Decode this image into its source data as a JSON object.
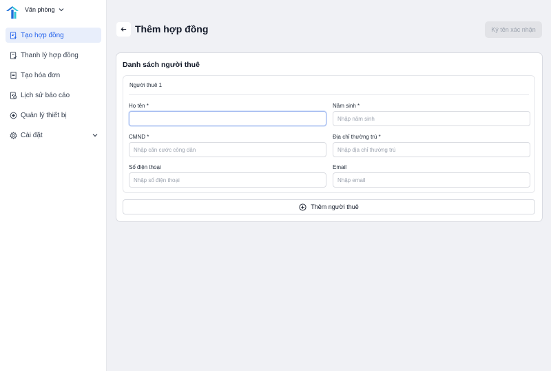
{
  "workspace": {
    "name": "Văn phòng",
    "logo_icon": "house-logo-icon",
    "dropdown_icon": "chevron-down-icon"
  },
  "sidebar": {
    "items": [
      {
        "label": "Tạo hợp đồng",
        "icon": "document-add-icon",
        "active": true
      },
      {
        "label": "Thanh lý hợp đồng",
        "icon": "document-check-icon",
        "active": false
      },
      {
        "label": "Tạo hóa đơn",
        "icon": "invoice-icon",
        "active": false
      },
      {
        "label": "Lịch sử báo cáo",
        "icon": "report-history-icon",
        "active": false
      },
      {
        "label": "Quản lý thiết bị",
        "icon": "device-icon",
        "active": false
      },
      {
        "label": "Cài đặt",
        "icon": "gear-icon",
        "active": false,
        "expandable": true
      }
    ]
  },
  "header": {
    "title": "Thêm hợp đồng",
    "back_icon": "arrow-left-icon",
    "confirm_label": "Ký tên xác nhận"
  },
  "card": {
    "title": "Danh sách người thuê",
    "tenant": {
      "heading": "Người thuê 1",
      "fields": {
        "full_name": {
          "label": "Họ tên *",
          "value": "",
          "placeholder": ""
        },
        "birth_year": {
          "label": "Năm sinh *",
          "value": "",
          "placeholder": "Nhập năm sinh"
        },
        "id_card": {
          "label": "CMND *",
          "value": "",
          "placeholder": "Nhập căn cước công dân"
        },
        "address": {
          "label": "Địa chỉ thường trú *",
          "value": "",
          "placeholder": "Nhập địa chỉ thường trú"
        },
        "phone": {
          "label": "Số điện thoại",
          "value": "",
          "placeholder": "Nhập số điện thoại"
        },
        "email": {
          "label": "Email",
          "value": "",
          "placeholder": "Nhập email"
        }
      }
    },
    "add_tenant_label": "Thêm người thuê"
  },
  "colors": {
    "accent": "#2563eb",
    "active_bg": "#e8eefb",
    "page_bg": "#f0f1f5",
    "disabled_btn_bg": "#e2e3e7",
    "logo_primary": "#1e6fd9",
    "logo_secondary": "#2ec4d6"
  }
}
